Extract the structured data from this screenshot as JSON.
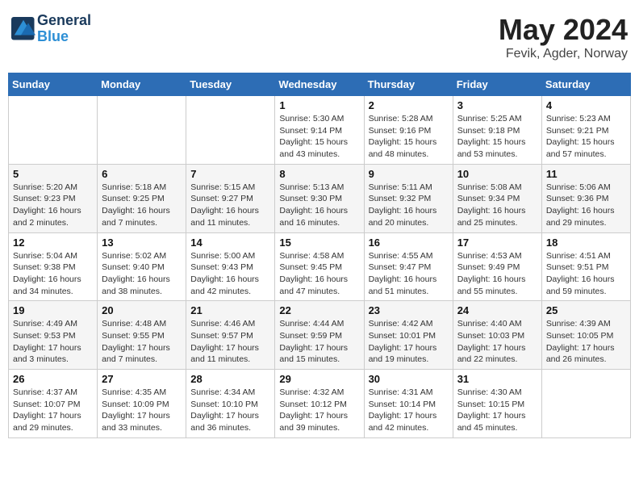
{
  "header": {
    "logo_line1": "General",
    "logo_line2": "Blue",
    "month_year": "May 2024",
    "location": "Fevik, Agder, Norway"
  },
  "weekdays": [
    "Sunday",
    "Monday",
    "Tuesday",
    "Wednesday",
    "Thursday",
    "Friday",
    "Saturday"
  ],
  "weeks": [
    [
      {
        "day": "",
        "info": ""
      },
      {
        "day": "",
        "info": ""
      },
      {
        "day": "",
        "info": ""
      },
      {
        "day": "1",
        "info": "Sunrise: 5:30 AM\nSunset: 9:14 PM\nDaylight: 15 hours\nand 43 minutes."
      },
      {
        "day": "2",
        "info": "Sunrise: 5:28 AM\nSunset: 9:16 PM\nDaylight: 15 hours\nand 48 minutes."
      },
      {
        "day": "3",
        "info": "Sunrise: 5:25 AM\nSunset: 9:18 PM\nDaylight: 15 hours\nand 53 minutes."
      },
      {
        "day": "4",
        "info": "Sunrise: 5:23 AM\nSunset: 9:21 PM\nDaylight: 15 hours\nand 57 minutes."
      }
    ],
    [
      {
        "day": "5",
        "info": "Sunrise: 5:20 AM\nSunset: 9:23 PM\nDaylight: 16 hours\nand 2 minutes."
      },
      {
        "day": "6",
        "info": "Sunrise: 5:18 AM\nSunset: 9:25 PM\nDaylight: 16 hours\nand 7 minutes."
      },
      {
        "day": "7",
        "info": "Sunrise: 5:15 AM\nSunset: 9:27 PM\nDaylight: 16 hours\nand 11 minutes."
      },
      {
        "day": "8",
        "info": "Sunrise: 5:13 AM\nSunset: 9:30 PM\nDaylight: 16 hours\nand 16 minutes."
      },
      {
        "day": "9",
        "info": "Sunrise: 5:11 AM\nSunset: 9:32 PM\nDaylight: 16 hours\nand 20 minutes."
      },
      {
        "day": "10",
        "info": "Sunrise: 5:08 AM\nSunset: 9:34 PM\nDaylight: 16 hours\nand 25 minutes."
      },
      {
        "day": "11",
        "info": "Sunrise: 5:06 AM\nSunset: 9:36 PM\nDaylight: 16 hours\nand 29 minutes."
      }
    ],
    [
      {
        "day": "12",
        "info": "Sunrise: 5:04 AM\nSunset: 9:38 PM\nDaylight: 16 hours\nand 34 minutes."
      },
      {
        "day": "13",
        "info": "Sunrise: 5:02 AM\nSunset: 9:40 PM\nDaylight: 16 hours\nand 38 minutes."
      },
      {
        "day": "14",
        "info": "Sunrise: 5:00 AM\nSunset: 9:43 PM\nDaylight: 16 hours\nand 42 minutes."
      },
      {
        "day": "15",
        "info": "Sunrise: 4:58 AM\nSunset: 9:45 PM\nDaylight: 16 hours\nand 47 minutes."
      },
      {
        "day": "16",
        "info": "Sunrise: 4:55 AM\nSunset: 9:47 PM\nDaylight: 16 hours\nand 51 minutes."
      },
      {
        "day": "17",
        "info": "Sunrise: 4:53 AM\nSunset: 9:49 PM\nDaylight: 16 hours\nand 55 minutes."
      },
      {
        "day": "18",
        "info": "Sunrise: 4:51 AM\nSunset: 9:51 PM\nDaylight: 16 hours\nand 59 minutes."
      }
    ],
    [
      {
        "day": "19",
        "info": "Sunrise: 4:49 AM\nSunset: 9:53 PM\nDaylight: 17 hours\nand 3 minutes."
      },
      {
        "day": "20",
        "info": "Sunrise: 4:48 AM\nSunset: 9:55 PM\nDaylight: 17 hours\nand 7 minutes."
      },
      {
        "day": "21",
        "info": "Sunrise: 4:46 AM\nSunset: 9:57 PM\nDaylight: 17 hours\nand 11 minutes."
      },
      {
        "day": "22",
        "info": "Sunrise: 4:44 AM\nSunset: 9:59 PM\nDaylight: 17 hours\nand 15 minutes."
      },
      {
        "day": "23",
        "info": "Sunrise: 4:42 AM\nSunset: 10:01 PM\nDaylight: 17 hours\nand 19 minutes."
      },
      {
        "day": "24",
        "info": "Sunrise: 4:40 AM\nSunset: 10:03 PM\nDaylight: 17 hours\nand 22 minutes."
      },
      {
        "day": "25",
        "info": "Sunrise: 4:39 AM\nSunset: 10:05 PM\nDaylight: 17 hours\nand 26 minutes."
      }
    ],
    [
      {
        "day": "26",
        "info": "Sunrise: 4:37 AM\nSunset: 10:07 PM\nDaylight: 17 hours\nand 29 minutes."
      },
      {
        "day": "27",
        "info": "Sunrise: 4:35 AM\nSunset: 10:09 PM\nDaylight: 17 hours\nand 33 minutes."
      },
      {
        "day": "28",
        "info": "Sunrise: 4:34 AM\nSunset: 10:10 PM\nDaylight: 17 hours\nand 36 minutes."
      },
      {
        "day": "29",
        "info": "Sunrise: 4:32 AM\nSunset: 10:12 PM\nDaylight: 17 hours\nand 39 minutes."
      },
      {
        "day": "30",
        "info": "Sunrise: 4:31 AM\nSunset: 10:14 PM\nDaylight: 17 hours\nand 42 minutes."
      },
      {
        "day": "31",
        "info": "Sunrise: 4:30 AM\nSunset: 10:15 PM\nDaylight: 17 hours\nand 45 minutes."
      },
      {
        "day": "",
        "info": ""
      }
    ]
  ]
}
